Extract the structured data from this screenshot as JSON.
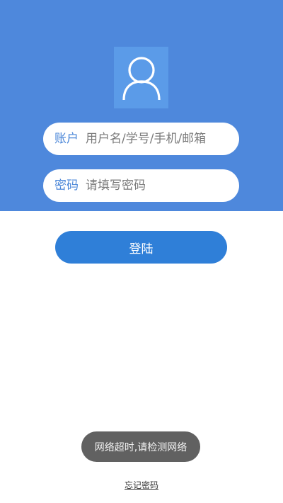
{
  "login": {
    "account_label": "账户",
    "account_placeholder": "用户名/学号/手机/邮箱",
    "password_label": "密码",
    "password_placeholder": "请填写密码",
    "submit_label": "登陆",
    "forgot_label": "忘记密码"
  },
  "toast": {
    "message": "网络超时,请检测网络"
  },
  "icons": {
    "avatar": "user-icon"
  },
  "colors": {
    "header_bg": "#4e88dc",
    "avatar_bg": "#5b9be8",
    "label": "#4a86d8",
    "button": "#2f7fd8",
    "toast_bg": "#616161"
  }
}
